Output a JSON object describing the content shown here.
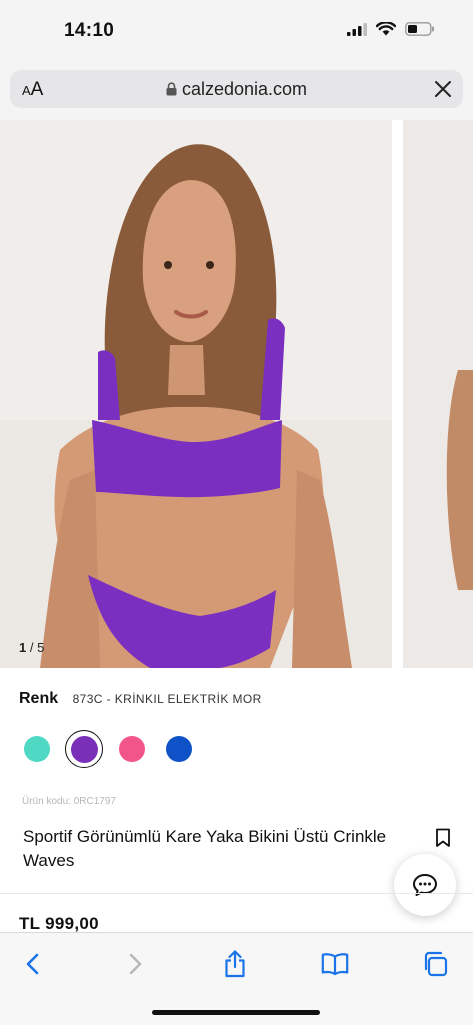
{
  "status_bar": {
    "time": "14:10"
  },
  "browser": {
    "text_size_label": "AA",
    "url": "calzedonia.com"
  },
  "gallery": {
    "current": "1",
    "separator": "/",
    "total": "5"
  },
  "product": {
    "color_label": "Renk",
    "color_name": "873C - KRİNKIL ELEKTRİK MOR",
    "swatches": [
      {
        "name": "turquoise",
        "hex": "#4fd8c4"
      },
      {
        "name": "purple",
        "hex": "#7a2fb8",
        "selected": true
      },
      {
        "name": "pink",
        "hex": "#f2558a"
      },
      {
        "name": "blue",
        "hex": "#0f52c8"
      }
    ],
    "code": "Ürün kodu: 0RC1797",
    "title": "Sportif Görünümlü Kare Yaka Bikini Üstü Crinkle Waves",
    "price": "TL 999,00"
  },
  "colors": {
    "accent": "#1a73e8",
    "swimsuit": "#7b2fc0",
    "background": "#f4f4f4"
  },
  "icons": [
    "cellular-icon",
    "wifi-icon",
    "battery-icon",
    "lock-icon",
    "close-icon",
    "bookmark-icon",
    "chat-icon",
    "back-icon",
    "forward-icon",
    "share-icon",
    "bookmarks-icon",
    "tabs-icon"
  ]
}
